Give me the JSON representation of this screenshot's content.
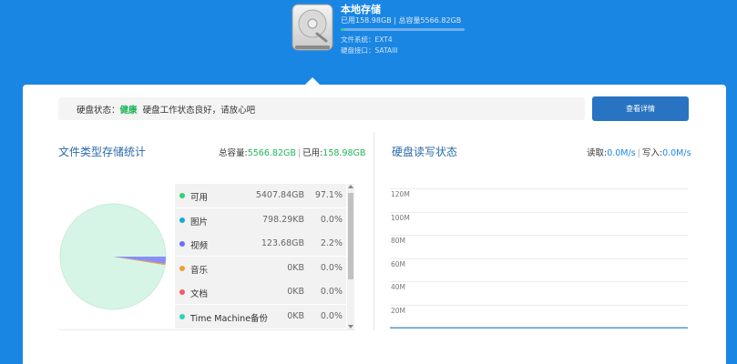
{
  "header": {
    "title": "本地存储",
    "usage_text": "已用158.98GB | 总容量5566.82GB",
    "used_fraction": 0.0286,
    "filesystem": "文件系统：EXT4",
    "interface": "硬盘接口：SATAIII"
  },
  "status": {
    "label": "硬盘状态：",
    "value": "健康",
    "message": "硬盘工作状态良好，请放心吧",
    "detail_button": "查看详情"
  },
  "storage_stats": {
    "title": "文件类型存储统计",
    "total_label": "总容量:",
    "total_value": "5566.82GB",
    "separator": "|",
    "used_label": "已用:",
    "used_value": "158.98GB"
  },
  "file_types": [
    {
      "name": "可用",
      "size": "5407.84GB",
      "percent": "97.1%",
      "color": "#2fd07a"
    },
    {
      "name": "图片",
      "size": "798.29KB",
      "percent": "0.0%",
      "color": "#1aa7e0"
    },
    {
      "name": "视频",
      "size": "123.68GB",
      "percent": "2.2%",
      "color": "#6b6ff0"
    },
    {
      "name": "音乐",
      "size": "0KB",
      "percent": "0.0%",
      "color": "#f0a030"
    },
    {
      "name": "文档",
      "size": "0KB",
      "percent": "0.0%",
      "color": "#f05a6a"
    },
    {
      "name": "Time Machine备份",
      "size": "0KB",
      "percent": "0.0%",
      "color": "#2dd0c0"
    }
  ],
  "pie_colors": {
    "available": "#d6f5e6",
    "video": "#8b8ff5",
    "other": "#f0a030"
  },
  "rw_status": {
    "title": "硬盘读写状态",
    "read_label": "读取:",
    "read_value": "0.0M/s",
    "separator": "|",
    "write_label": "写入:",
    "write_value": "0.0M/s"
  },
  "chart_data": {
    "type": "line",
    "title": "",
    "xlabel": "",
    "ylabel": "",
    "y_ticks": [
      "120M",
      "100M",
      "80M",
      "60M",
      "40M",
      "20M"
    ],
    "ylim": [
      0,
      120
    ],
    "series": [
      {
        "values": [
          0,
          0,
          0,
          0,
          0,
          0,
          0,
          0,
          0,
          0
        ]
      }
    ],
    "grid": true
  }
}
